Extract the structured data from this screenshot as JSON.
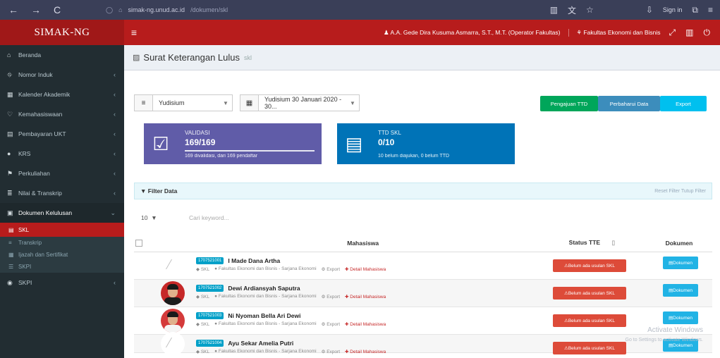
{
  "browser": {
    "back": "←",
    "forward": "→",
    "reload": "C",
    "url_host": "simak-ng.unud.ac.id",
    "url_path": "/dokumen/skl",
    "sign_in": "Sign in"
  },
  "topbar": {
    "brand": "SIMAK-NG",
    "user": "A.A. Gede Dira Kusuma Asmarra, S.T., M.T. (Operator Fakultas)",
    "faculty": "Fakultas Ekonomi dan Bisnis"
  },
  "sidebar": {
    "items": [
      {
        "icon": "home-icon",
        "glyph": "⌂",
        "label": "Beranda",
        "chev": false
      },
      {
        "icon": "sitemap-icon",
        "glyph": "⛗",
        "label": "Nomor Induk",
        "chev": true
      },
      {
        "icon": "calendar-icon",
        "glyph": "▦",
        "label": "Kalender Akademik",
        "chev": true
      },
      {
        "icon": "heart-icon",
        "glyph": "♡",
        "label": "Kemahasiswaan",
        "chev": true
      },
      {
        "icon": "book-icon",
        "glyph": "▤",
        "label": "Pembayaran UKT",
        "chev": true
      },
      {
        "icon": "users-icon",
        "glyph": "●",
        "label": "KRS",
        "chev": true
      },
      {
        "icon": "flag-icon",
        "glyph": "⚑",
        "label": "Perkuliahan",
        "chev": true
      },
      {
        "icon": "chart-icon",
        "glyph": "≣",
        "label": "Nilai & Transkrip",
        "chev": true
      },
      {
        "icon": "folder-icon",
        "glyph": "▣",
        "label": "Dokumen Kelulusan",
        "chev": true,
        "open": true
      }
    ],
    "subitems": [
      {
        "icon": "doc-icon",
        "glyph": "▤",
        "label": "SKL",
        "active": true
      },
      {
        "icon": "list-icon",
        "glyph": "≡",
        "label": "Transkrip"
      },
      {
        "icon": "certificate-icon",
        "glyph": "▦",
        "label": "Ijazah dan Sertifikat"
      },
      {
        "icon": "file-icon",
        "glyph": "☰",
        "label": "SKPI"
      }
    ],
    "last": {
      "icon": "globe-icon",
      "glyph": "◉",
      "label": "SKPI"
    }
  },
  "page": {
    "title": "Surat Keterangan Lulus",
    "subtitle": "skl"
  },
  "filters": {
    "type_value": "Yudisium",
    "period_value": "Yudisium 30 Januari 2020 - 30..."
  },
  "buttons": {
    "ttd": "Pengajuan TTD",
    "refresh": "Perbaharui Data",
    "export": "Export"
  },
  "stats": [
    {
      "label": "VALIDASI",
      "value": "169/169",
      "desc": "169 divalidasi, dari 169 pendaftar",
      "color": "#605ca8"
    },
    {
      "label": "TTD SKL",
      "value": "0/10",
      "desc": "10 belum diajukan, 0 belum TTD",
      "color": "#0073b7"
    }
  ],
  "filter_bar": {
    "label": "Filter Data",
    "right": "Reset Filter   Tutup Filter"
  },
  "table": {
    "length": "10",
    "search_placeholder": "Cari keyword...",
    "headers": {
      "mahasiswa": "Mahasiswa",
      "status": "Status TTE",
      "dokumen": "Dokumen"
    },
    "rows": [
      {
        "nim": "1707521001",
        "name": "I Made Dana Artha",
        "prodi": "Fakultas Ekonomi dan Bisnis - Sarjana Ekonomi",
        "status": "Belum ada usulan SKL",
        "doc": "Dokumen",
        "avatar": "empty"
      },
      {
        "nim": "1707521002",
        "name": "Dewi Ardiansyah Saputra",
        "prodi": "Fakultas Ekonomi dan Bisnis - Sarjana Ekonomi",
        "status": "Belum ada usulan SKL",
        "doc": "Dokumen",
        "avatar": "photo"
      },
      {
        "nim": "1707521003",
        "name": "Ni Nyoman Bella Ari Dewi",
        "prodi": "Fakultas Ekonomi dan Bisnis - Sarjana Ekonomi",
        "status": "Belum ada usulan SKL",
        "doc": "Dokumen",
        "avatar": "photo2"
      },
      {
        "nim": "1707521004",
        "name": "Ayu Sekar Amelia Putri",
        "prodi": "Fakultas Ekonomi dan Bisnis - Sarjana Ekonomi",
        "status": "Belum ada usulan SKL",
        "doc": "Dokumen",
        "avatar": "empty"
      }
    ],
    "row_meta": {
      "skl": "SKL",
      "export": "Export",
      "detail": "Detail Mahasiswa"
    }
  },
  "watermark": {
    "line1": "Activate Windows",
    "line2": "Go to Settings to activate Windows."
  },
  "colors": {
    "brand": "#b71c1c",
    "sidebar": "#222d32",
    "danger": "#dd4b39",
    "info": "#21b3e5",
    "success": "#00a65a"
  }
}
